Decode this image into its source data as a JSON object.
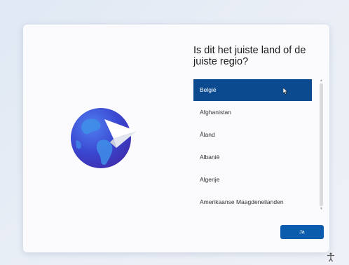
{
  "dialog": {
    "title": "Is dit het juiste land of de juiste regio?",
    "selected_index": 0
  },
  "countries": [
    "België",
    "Afghanistan",
    "Åland",
    "Albanië",
    "Algerije",
    "Amerikaanse Maagdeneilanden"
  ],
  "buttons": {
    "confirm_label": "Ja"
  },
  "colors": {
    "accent": "#0b4a8e",
    "button": "#0b5cad",
    "background": "#e9eef6",
    "card": "#fbfbfd"
  },
  "icons": {
    "illustration": "globe-with-paper-plane-icon",
    "accessibility": "accessibility-icon",
    "cursor": "mouse-cursor-icon"
  }
}
